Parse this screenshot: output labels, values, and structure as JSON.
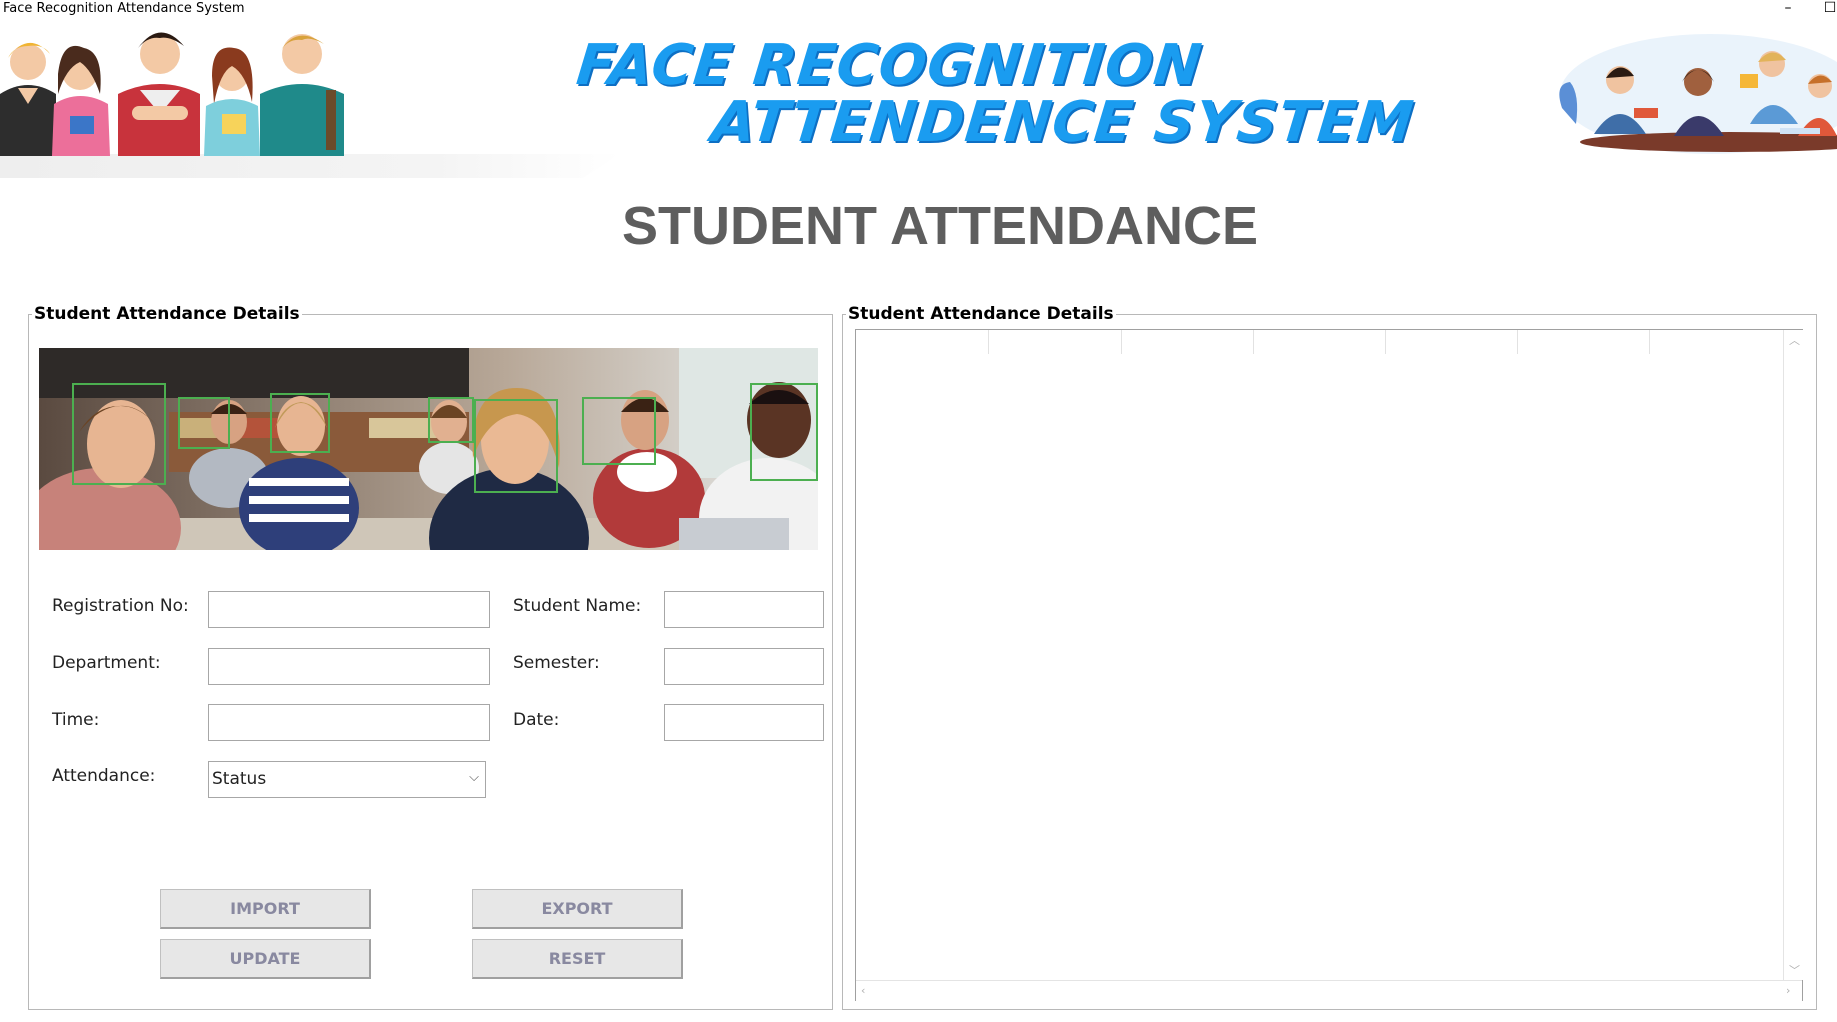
{
  "window": {
    "title": "Face Recognition Attendance System",
    "minimize_glyph": "–",
    "maximize_glyph": "☐"
  },
  "header": {
    "brand_line1": "FACE RECOGNITION",
    "brand_line2": "ATTENDENCE SYSTEM",
    "brand_color": "#1a9cf0"
  },
  "page_title": "STUDENT ATTENDANCE",
  "left_panel": {
    "title": "Student Attendance Details",
    "fields": {
      "registration_no": {
        "label": "Registration No:",
        "value": ""
      },
      "student_name": {
        "label": "Student Name:",
        "value": ""
      },
      "department": {
        "label": "Department:",
        "value": ""
      },
      "semester": {
        "label": "Semester:",
        "value": ""
      },
      "time": {
        "label": "Time:",
        "value": ""
      },
      "date": {
        "label": "Date:",
        "value": ""
      },
      "attendance": {
        "label": "Attendance:",
        "selected": "Status"
      }
    },
    "buttons": {
      "import": "IMPORT",
      "export": "EXPORT",
      "update": "UPDATE",
      "reset": "RESET"
    }
  },
  "right_panel": {
    "title": "Student Attendance Details"
  },
  "icons": {
    "dropdown": "chevron-down-icon",
    "scroll_up": "chevron-up-icon",
    "scroll_down": "chevron-down-icon",
    "scroll_left": "chevron-left-icon",
    "scroll_right": "chevron-right-icon"
  }
}
